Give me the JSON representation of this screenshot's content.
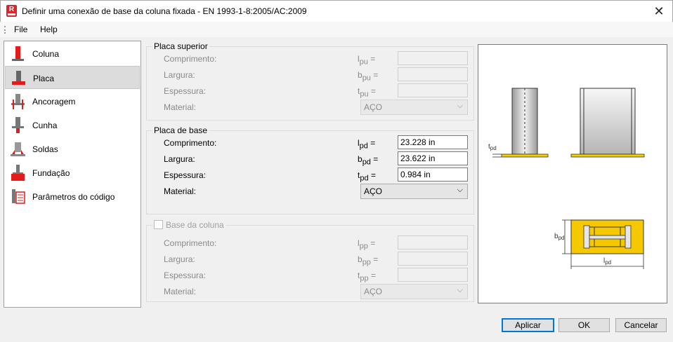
{
  "window": {
    "title": "Definir uma conexão de base da coluna fixada - EN 1993-1-8:2005/AC:2009",
    "app_icon_letter": "R",
    "close_glyph": "✕"
  },
  "menu": {
    "file": "File",
    "help": "Help"
  },
  "sidebar": {
    "items": [
      {
        "label": "Coluna",
        "icon": "column-icon"
      },
      {
        "label": "Placa",
        "icon": "plate-icon",
        "selected": true
      },
      {
        "label": "Ancoragem",
        "icon": "anchor-icon"
      },
      {
        "label": "Cunha",
        "icon": "wedge-icon"
      },
      {
        "label": "Soldas",
        "icon": "weld-icon"
      },
      {
        "label": "Fundação",
        "icon": "foundation-icon"
      },
      {
        "label": "Parâmetros do código",
        "icon": "code-parameters-icon"
      }
    ]
  },
  "top_plate": {
    "title": "Placa superior",
    "length_label": "Comprimento:",
    "length_sym": "l",
    "length_sub": "pu",
    "width_label": "Largura:",
    "width_sym": "b",
    "width_sub": "pu",
    "thickness_label": "Espessura:",
    "thickness_sym": "t",
    "thickness_sub": "pu",
    "material_label": "Material:",
    "material_value": "AÇO",
    "length_value": "",
    "width_value": "",
    "thickness_value": ""
  },
  "base_plate": {
    "title": "Placa de base",
    "length_label": "Comprimento:",
    "length_sym": "l",
    "length_sub": "pd",
    "length_value": "23.228 in",
    "width_label": "Largura:",
    "width_sym": "b",
    "width_sub": "pd",
    "width_value": "23.622 in",
    "thickness_label": "Espessura:",
    "thickness_sym": "t",
    "thickness_sub": "pd",
    "thickness_value": "0.984 in",
    "material_label": "Material:",
    "material_value": "AÇO"
  },
  "column_base": {
    "title": "Base da coluna",
    "checked": false,
    "length_label": "Comprimento:",
    "length_sym": "l",
    "length_sub": "pp",
    "width_label": "Largura:",
    "width_sym": "b",
    "width_sub": "pp",
    "thickness_label": "Espessura:",
    "thickness_sym": "t",
    "thickness_sub": "pp",
    "material_label": "Material:",
    "material_value": "AÇO",
    "length_value": "",
    "width_value": "",
    "thickness_value": ""
  },
  "preview": {
    "t_label": "t",
    "t_sub": "pd",
    "b_label": "b",
    "b_sub": "pd",
    "l_label": "l",
    "l_sub": "pd"
  },
  "equals_sign": "=",
  "chevron_glyph": "⌵",
  "buttons": {
    "apply": "Aplicar",
    "ok": "OK",
    "cancel": "Cancelar"
  },
  "colors": {
    "accent_blue": "#0078d7",
    "icon_red": "#e21b1b",
    "plate_yellow": "#f5d000"
  }
}
